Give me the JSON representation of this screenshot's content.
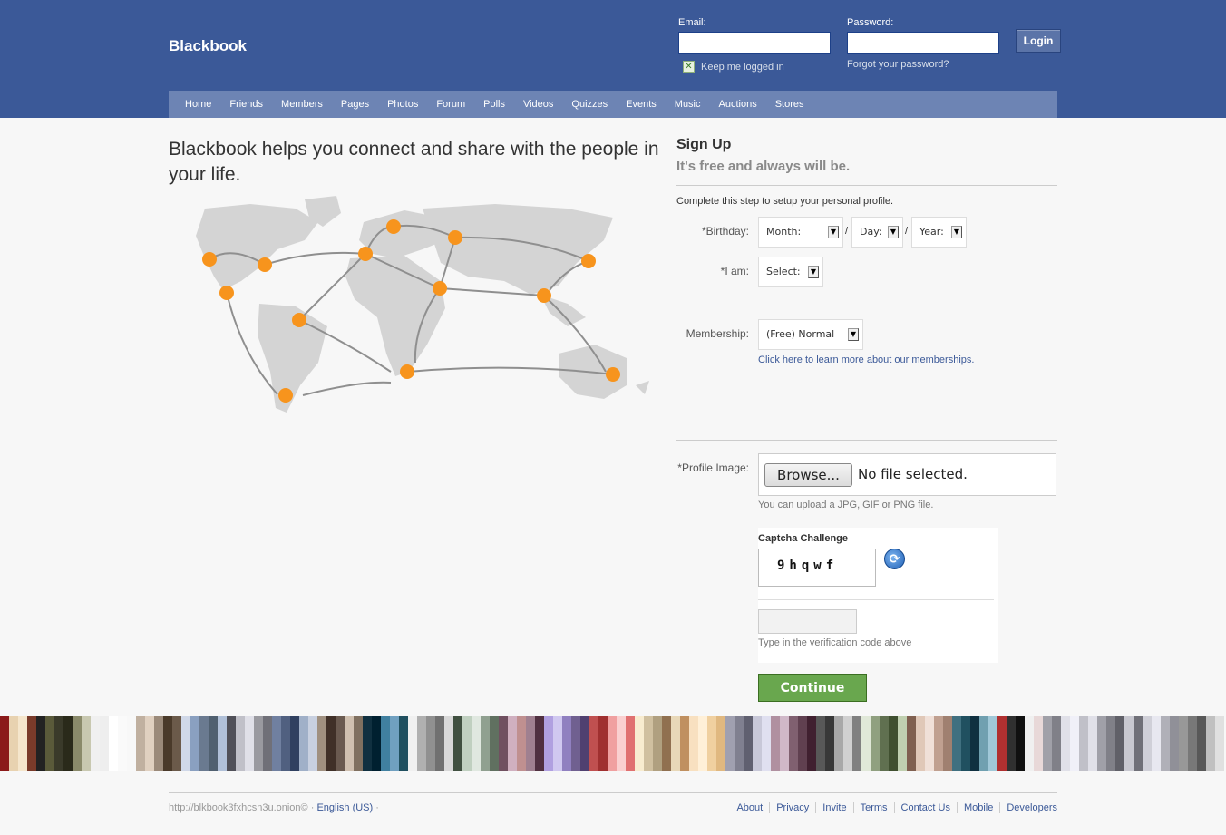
{
  "header": {
    "logo": "Blackbook",
    "email_label": "Email:",
    "password_label": "Password:",
    "login_button": "Login",
    "keep_logged_in": "Keep me logged in",
    "forgot_password": "Forgot your password?"
  },
  "nav": {
    "items": [
      "Home",
      "Friends",
      "Members",
      "Pages",
      "Photos",
      "Forum",
      "Polls",
      "Videos",
      "Quizzes",
      "Events",
      "Music",
      "Auctions",
      "Stores"
    ]
  },
  "main": {
    "tagline": "Blackbook helps you connect and share with the people in your life."
  },
  "signup": {
    "title": "Sign Up",
    "subtitle": "It's free and always will be.",
    "intro": "Complete this step to setup your personal profile.",
    "birthday_label": "*Birthday:",
    "month": "Month:",
    "day": "Day:",
    "year": "Year:",
    "separator": "/",
    "iam_label": "*I am:",
    "iam_value": "Select:",
    "membership_label": "Membership:",
    "membership_value": "(Free) Normal",
    "membership_link": "Click here to learn more about our memberships.",
    "profile_image_label": "*Profile Image:",
    "browse_button": "Browse...",
    "no_file": "No file selected.",
    "file_hint": "You can upload a JPG, GIF or PNG file.",
    "captcha_title": "Captcha Challenge",
    "captcha_code": "9hqwf",
    "captcha_hint": "Type in the verification code above",
    "continue_button": "Continue"
  },
  "colors": {
    "brand": "#3b5998",
    "nav": "#6d84b4",
    "continue": "#69a74e",
    "map_dot": "#f7941d"
  },
  "footer": {
    "onion": "http://blkbook3fxhcsn3u.onion©",
    "language": "English (US)",
    "links": [
      "About",
      "Privacy",
      "Invite",
      "Terms",
      "Contact Us",
      "Mobile",
      "Developers"
    ]
  }
}
